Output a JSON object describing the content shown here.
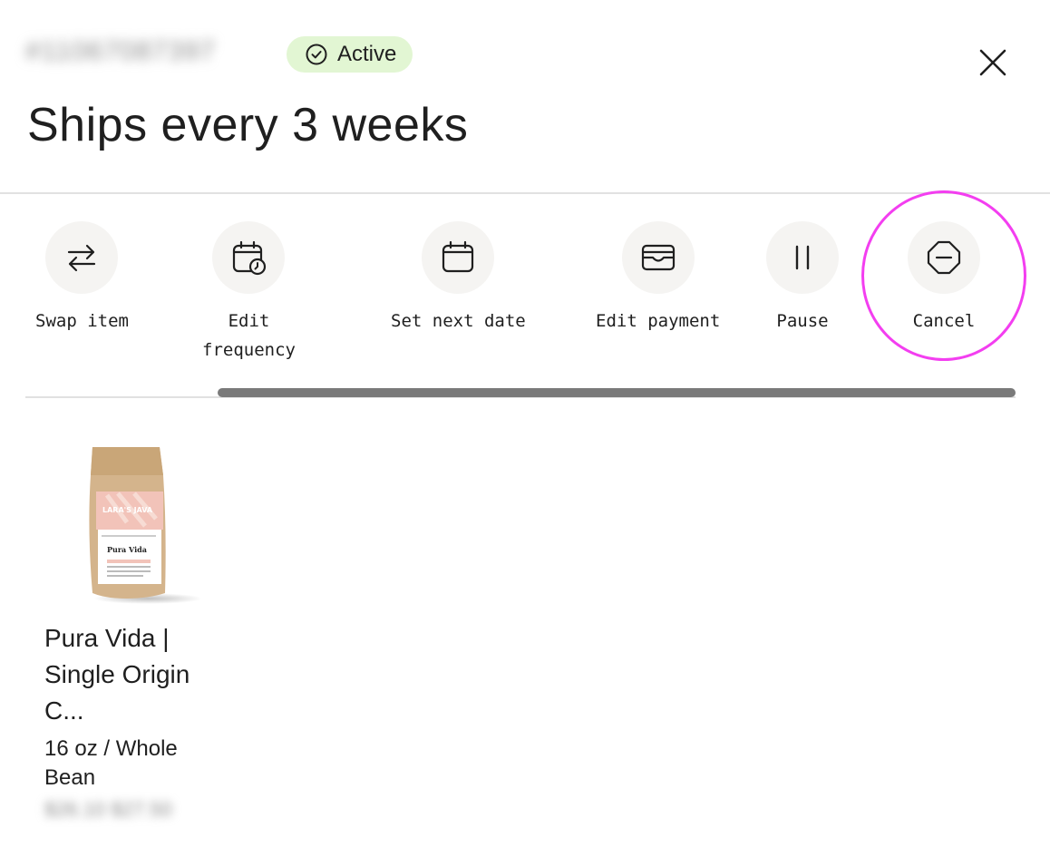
{
  "header": {
    "order_id": "#11067087397",
    "status": "Active",
    "title": "Ships every 3 weeks"
  },
  "actions": [
    {
      "label": "Swap item",
      "icon": "swap-arrows-icon"
    },
    {
      "label": "Edit\nfrequency",
      "icon": "calendar-clock-icon"
    },
    {
      "label": "Set next date",
      "icon": "calendar-icon"
    },
    {
      "label": "Edit payment",
      "icon": "wallet-icon"
    },
    {
      "label": "Pause",
      "icon": "pause-icon"
    },
    {
      "label": "Cancel",
      "icon": "octagon-minus-icon"
    }
  ],
  "product": {
    "name": "Pura Vida | Single Origin C...",
    "variant": "16 oz / Whole Bean",
    "price": "$26.10 $27.50",
    "bag_brand": "LARA'S JAVA",
    "bag_title": "Pura Vida"
  },
  "colors": {
    "badge_bg": "#e2f6d3",
    "highlight": "#f33ef0",
    "action_circle": "#f5f4f2",
    "scroll_thumb": "#7a7a7a"
  }
}
